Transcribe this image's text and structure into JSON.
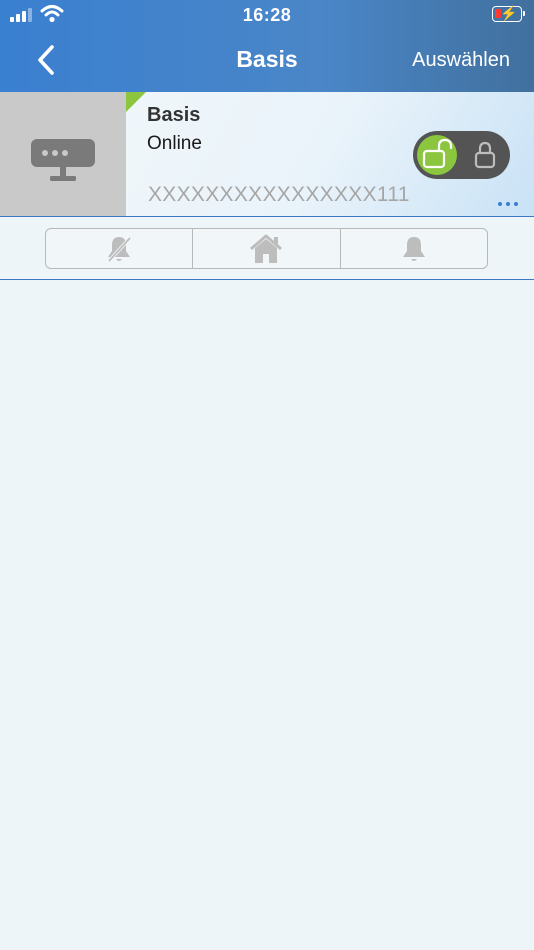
{
  "status_bar": {
    "time": "16:28"
  },
  "nav": {
    "title": "Basis",
    "select_label": "Auswählen"
  },
  "device": {
    "name": "Basis",
    "status": "Online",
    "id": "XXXXXXXXXXXXXXXX111",
    "lock_state": "unlocked"
  },
  "mode_bar": {
    "items": [
      "alarm-off-icon",
      "home-icon",
      "alarm-on-icon"
    ]
  },
  "colors": {
    "header": "#3a80d0",
    "accent_green": "#8cc63f",
    "divider_blue": "#3f78c2"
  }
}
